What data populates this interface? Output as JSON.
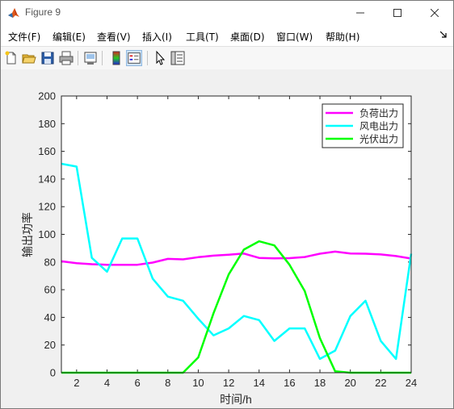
{
  "window": {
    "title": "Figure 9"
  },
  "menu": {
    "items": [
      "文件(F)",
      "编辑(E)",
      "查看(V)",
      "插入(I)",
      "工具(T)",
      "桌面(D)",
      "窗口(W)",
      "帮助(H)"
    ],
    "overflow_icon": "corner-arrow-icon"
  },
  "toolbar": {
    "icons": [
      "new-file-icon",
      "open-folder-icon",
      "save-icon",
      "print-icon",
      "link-plot-icon",
      "colorbar-icon",
      "legend-icon",
      "pointer-icon",
      "property-editor-icon"
    ]
  },
  "chart_data": {
    "type": "line",
    "xlabel": "时间/h",
    "ylabel": "输出功率",
    "xlim": [
      1,
      24
    ],
    "ylim": [
      0,
      200
    ],
    "xticks": [
      2,
      4,
      6,
      8,
      10,
      12,
      14,
      16,
      18,
      20,
      22,
      24
    ],
    "yticks": [
      0,
      20,
      40,
      60,
      80,
      100,
      120,
      140,
      160,
      180,
      200
    ],
    "legend_position": "top-right",
    "grid": false,
    "x": [
      1,
      2,
      3,
      4,
      5,
      6,
      7,
      8,
      9,
      10,
      11,
      12,
      13,
      14,
      15,
      16,
      17,
      18,
      19,
      20,
      21,
      22,
      23,
      24
    ],
    "series": [
      {
        "name": "负荷出力",
        "color": "#ff00ff",
        "values": [
          80.5,
          79.2,
          78.4,
          78.0,
          78.0,
          78.0,
          79.6,
          82.3,
          81.9,
          83.5,
          84.6,
          85.3,
          86.1,
          83.0,
          82.7,
          82.8,
          83.6,
          86.0,
          87.5,
          86.2,
          86.0,
          85.5,
          84.3,
          82.5
        ]
      },
      {
        "name": "风电出力",
        "color": "#00ffff",
        "values": [
          151,
          149,
          83,
          73,
          97,
          97,
          68,
          55,
          52,
          39,
          27,
          32,
          41,
          38,
          23,
          32,
          32,
          10,
          16,
          41,
          52,
          23,
          10,
          86
        ]
      },
      {
        "name": "光伏出力",
        "color": "#00ff00",
        "values": [
          0,
          0,
          0,
          0,
          0,
          0,
          0,
          0,
          0,
          11,
          43,
          71,
          89,
          95,
          92,
          78,
          59,
          25,
          1,
          0,
          0,
          0,
          0,
          0
        ]
      }
    ]
  }
}
